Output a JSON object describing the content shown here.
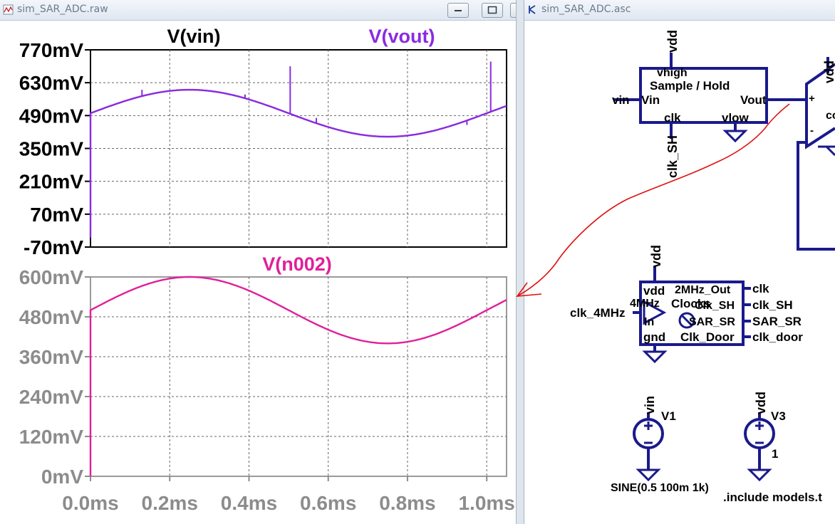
{
  "waveform_window": {
    "title": "sim_SAR_ADC.raw",
    "top_pane": {
      "traces": [
        {
          "name": "V(vin)",
          "color": "#000000"
        },
        {
          "name": "V(vout)",
          "color": "#8a2be2"
        }
      ],
      "y_ticks": [
        "770mV",
        "630mV",
        "490mV",
        "350mV",
        "210mV",
        "70mV",
        "-70mV"
      ]
    },
    "bottom_pane": {
      "traces": [
        {
          "name": "V(n002)",
          "color": "#e0209a"
        }
      ],
      "y_ticks": [
        "600mV",
        "480mV",
        "360mV",
        "240mV",
        "120mV",
        "0mV"
      ]
    },
    "x_ticks": [
      "0.0ms",
      "0.2ms",
      "0.4ms",
      "0.6ms",
      "0.8ms",
      "1.0ms"
    ]
  },
  "chart_data": [
    {
      "type": "line",
      "series": [
        {
          "name": "V(vin)",
          "x": [
            0.0,
            0.25,
            0.5,
            0.75,
            1.0
          ],
          "y": [
            500,
            600,
            500,
            400,
            500
          ]
        },
        {
          "name": "V(vout)",
          "x": [
            0.0,
            0.25,
            0.5,
            0.75,
            1.0
          ],
          "y": [
            500,
            600,
            500,
            400,
            500
          ]
        }
      ],
      "xlabel": "",
      "ylabel": "",
      "xlim": [
        0.0,
        1.05
      ],
      "ylim": [
        -70,
        770
      ],
      "grid": true
    },
    {
      "type": "line",
      "series": [
        {
          "name": "V(n002)",
          "x": [
            0.0,
            0.25,
            0.5,
            0.75,
            1.0
          ],
          "y": [
            500,
            600,
            500,
            400,
            500
          ]
        }
      ],
      "xlabel": "",
      "ylabel": "",
      "xlim": [
        0.0,
        1.05
      ],
      "ylim": [
        0,
        600
      ],
      "grid": true
    }
  ],
  "schematic_window": {
    "title": "sim_SAR_ADC.asc",
    "sample_hold": {
      "name": "Sample / Hold",
      "pins": {
        "vhigh": "vhigh",
        "vin": "Vin",
        "vout": "Vout",
        "clk": "clk",
        "vlow": "vlow"
      },
      "nets": {
        "vdd": "vdd",
        "vin": "vin",
        "clk": "clk_SH"
      }
    },
    "comparator": {
      "name": "co",
      "plus": "+",
      "minus": "-",
      "vdd": "vdd"
    },
    "clocks": {
      "name": "Clocks",
      "pins": {
        "vdd": "vdd",
        "in_freq": "4MHz",
        "in": "In",
        "gnd": "gnd",
        "out1": "2MHz_Out",
        "out2": "Clk_SH",
        "out3": "SAR_SR",
        "out4": "Clk_Door"
      },
      "nets": {
        "vdd": "vdd",
        "in": "clk_4MHz",
        "out1": "clk",
        "out2": "clk_SH",
        "out3": "SAR_SR",
        "out4": "clk_door"
      }
    },
    "v1": {
      "name": "V1",
      "net": "vin",
      "value": "SINE(0.5 100m 1k)"
    },
    "v3": {
      "name": "V3",
      "net": "vdd",
      "value": "1"
    },
    "directive": ".include models.t"
  }
}
